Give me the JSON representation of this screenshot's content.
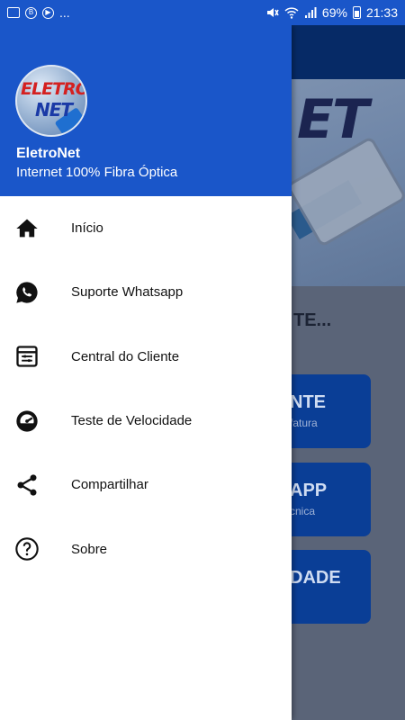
{
  "status_bar": {
    "notif_icons": [
      "image-icon",
      "b-icon",
      "play-icon"
    ],
    "more": "...",
    "battery": "69%",
    "time": "21:33"
  },
  "drawer": {
    "header": {
      "logo_text_1": "ELETRO",
      "logo_text_2": "NET",
      "title": "EletroNet",
      "subtitle": "Internet 100% Fibra Óptica"
    },
    "items": [
      {
        "label": "Início",
        "icon": "home-icon"
      },
      {
        "label": "Suporte Whatsapp",
        "icon": "whatsapp-icon"
      },
      {
        "label": "Central do Cliente",
        "icon": "settings-panel-icon"
      },
      {
        "label": "Teste de Velocidade",
        "icon": "speedtest-icon"
      },
      {
        "label": "Compartilhar",
        "icon": "share-icon"
      },
      {
        "label": "Sobre",
        "icon": "help-icon"
      }
    ]
  },
  "background": {
    "hero_logo": "ET",
    "partial_text": "TE...",
    "buttons": [
      {
        "title": "NTE",
        "sub": "fatura"
      },
      {
        "title": "APP",
        "sub": "cnica"
      },
      {
        "title": "DADE",
        "sub": ""
      }
    ]
  },
  "colors": {
    "primary": "#1a56c9",
    "dark_blue": "#0a3e96"
  }
}
